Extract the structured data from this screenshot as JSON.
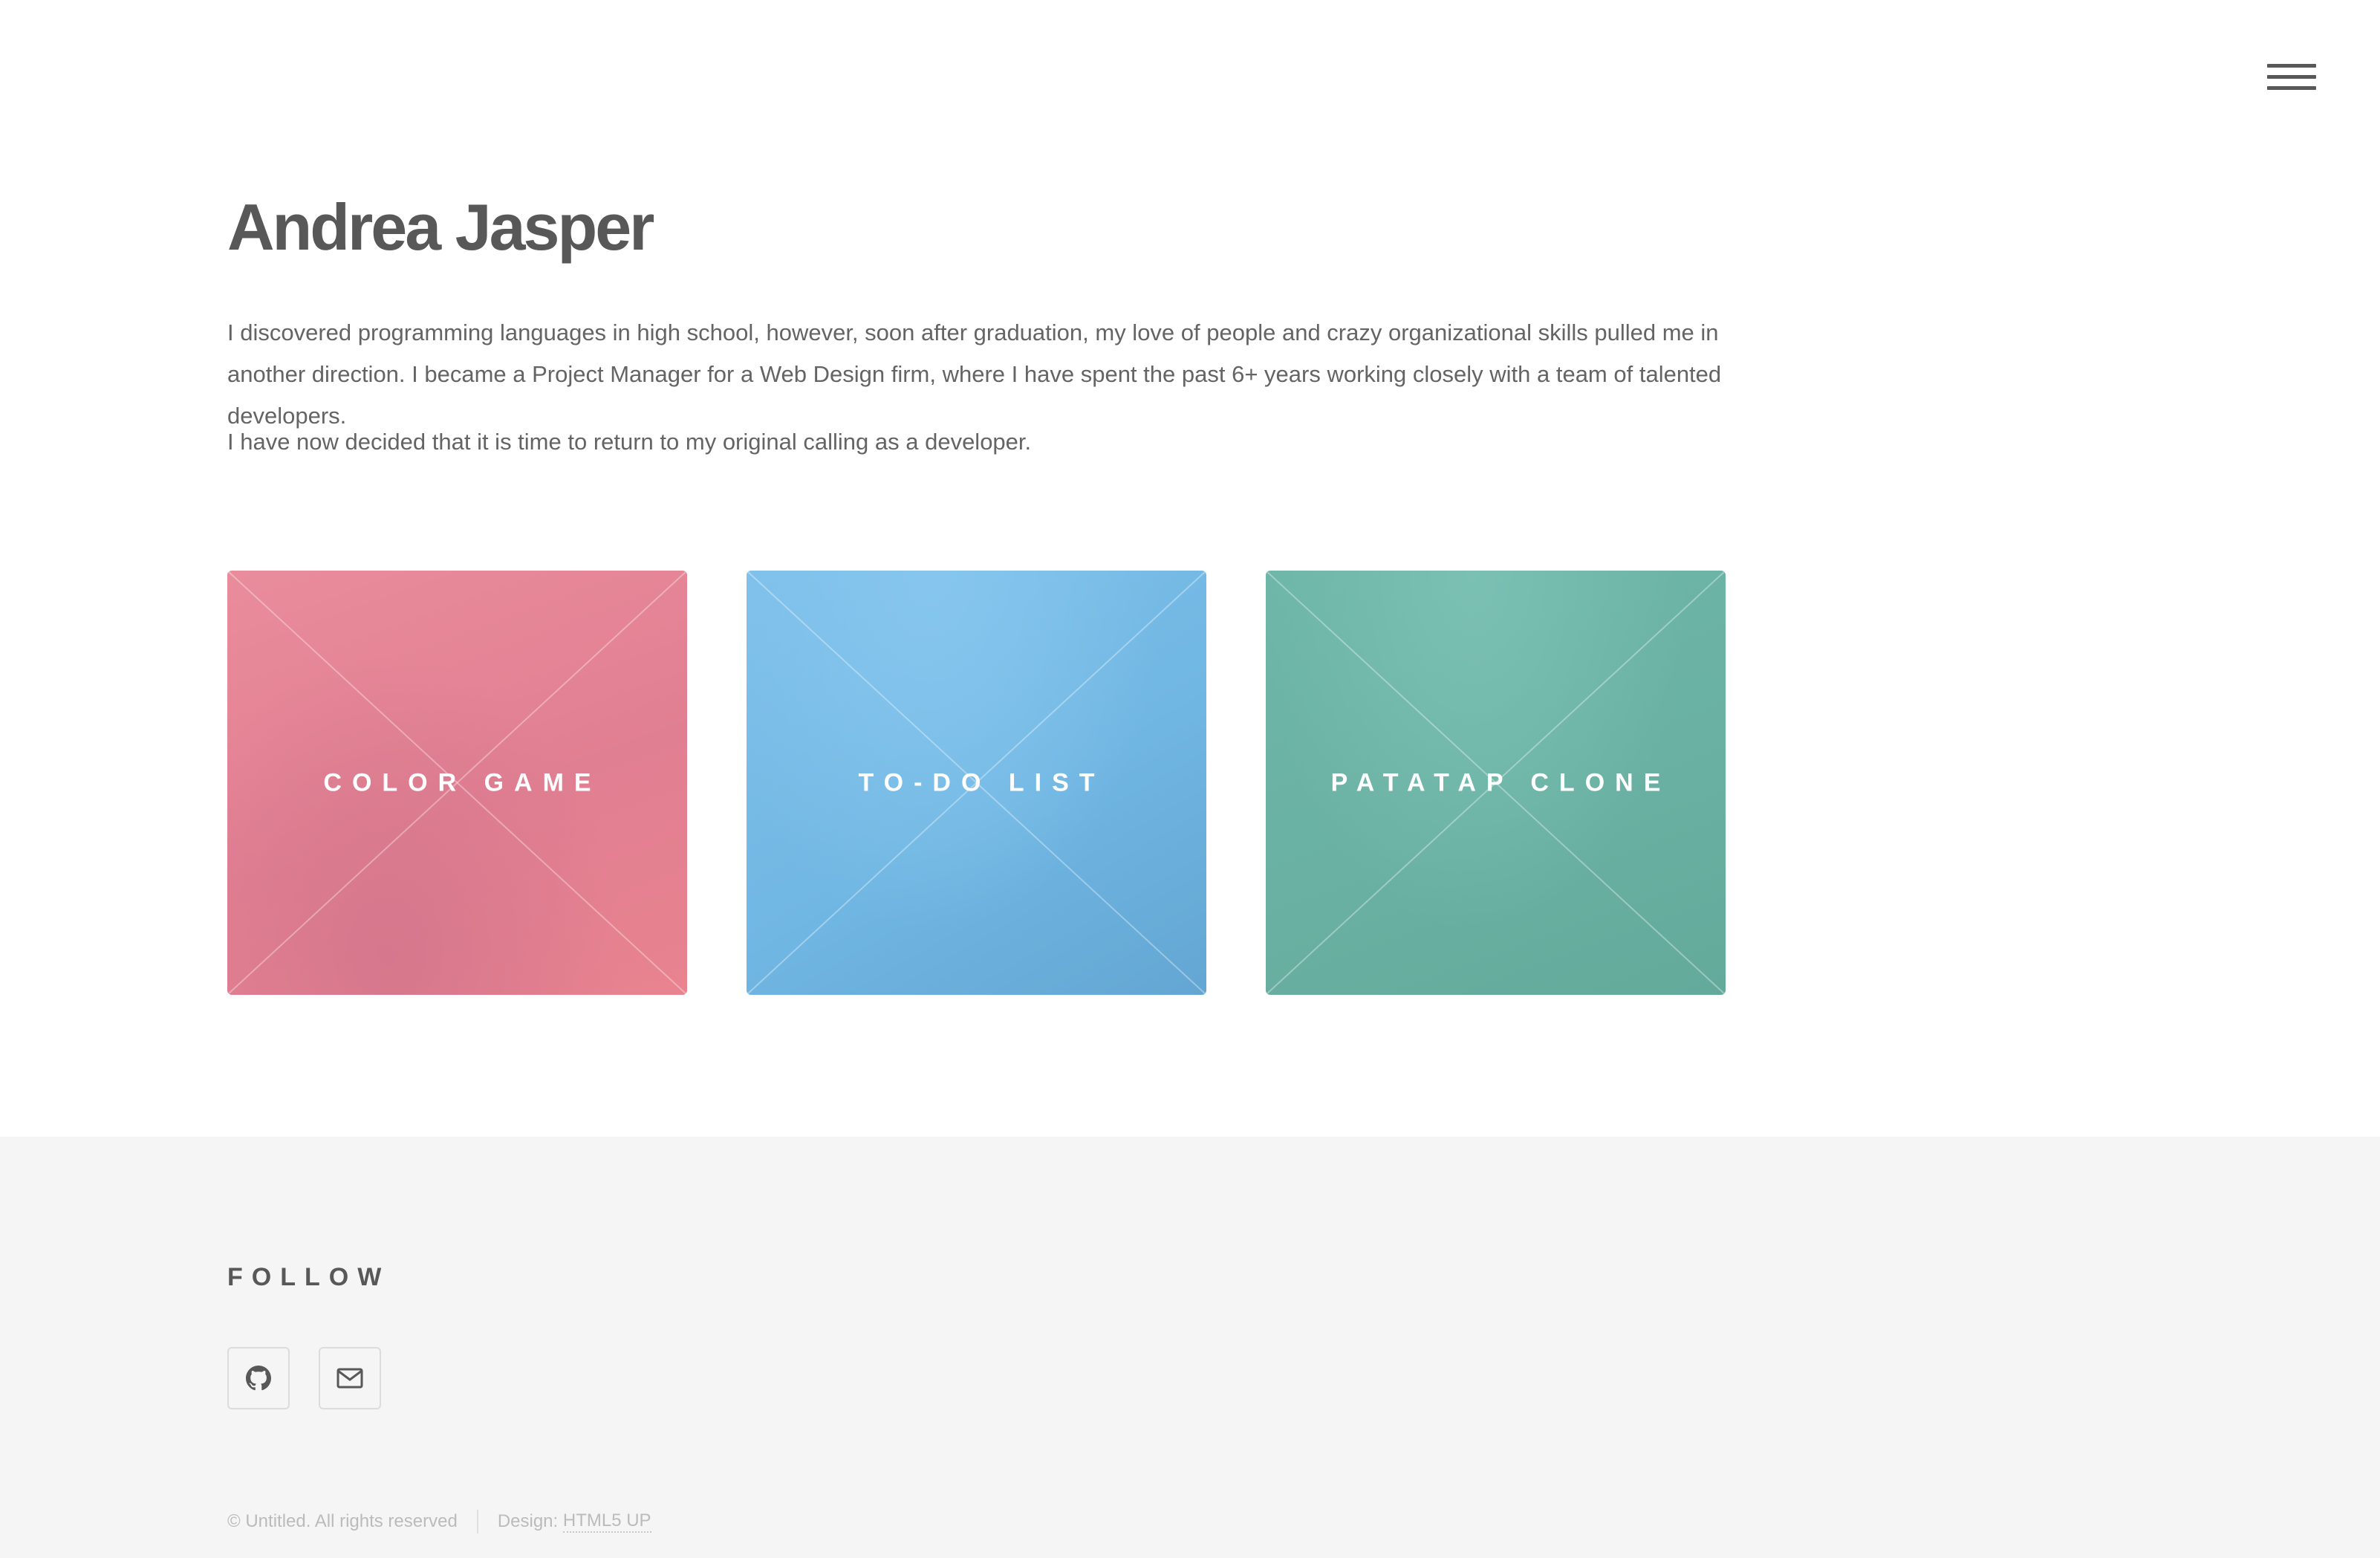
{
  "header": {
    "menu_icon": "hamburger-menu-icon"
  },
  "main": {
    "title": "Andrea Jasper",
    "intro_paragraph_1": "I discovered programming languages in high school, however, soon after graduation, my love of people and crazy organizational skills pulled me in another direction. I became a Project Manager for a Web Design firm, where I have spent the past 6+ years working closely with a team of talented developers.",
    "intro_paragraph_2": "I have now decided that it is time to return to my original calling as a developer.",
    "tiles": [
      {
        "label": "COLOR GAME",
        "color": "#e5879a"
      },
      {
        "label": "TO-DO LIST",
        "color": "#77bbe7"
      },
      {
        "label": "PATATAP CLONE",
        "color": "#6bb3a5"
      }
    ]
  },
  "footer": {
    "follow_heading": "FOLLOW",
    "social": [
      {
        "icon": "github-icon"
      },
      {
        "icon": "email-icon"
      }
    ],
    "copyright_text": "© Untitled. All rights reserved",
    "design_label": "Design: ",
    "design_link": "HTML5 UP",
    "background_color": "#f5f5f5"
  }
}
